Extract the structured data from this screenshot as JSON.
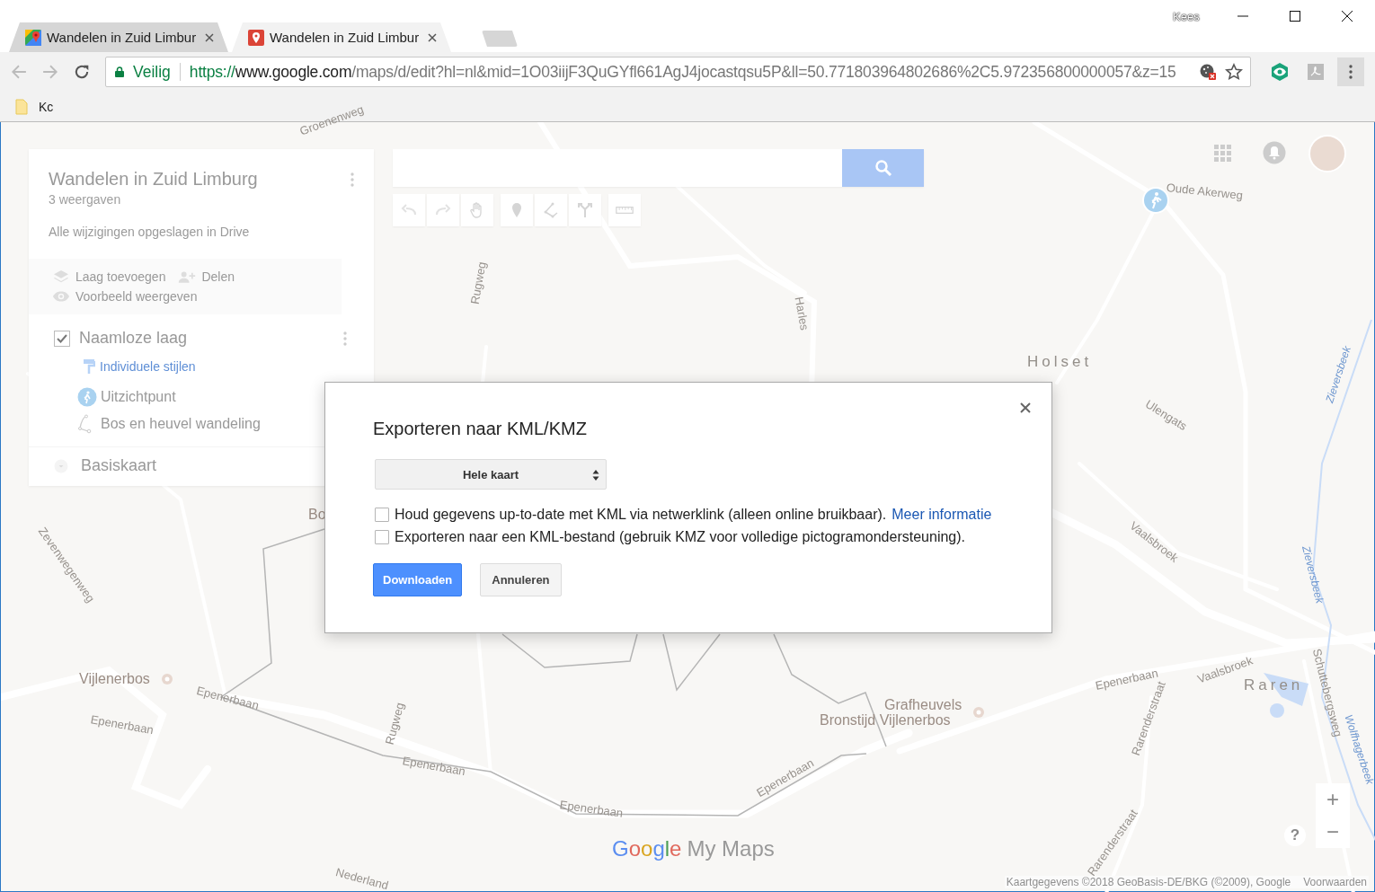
{
  "browser": {
    "tabs": [
      {
        "title": "Wandelen in Zuid Limbur",
        "selected": false
      },
      {
        "title": "Wandelen in Zuid Limbur",
        "selected": true
      }
    ],
    "profile": "Kees",
    "address": {
      "secure_label": "Veilig",
      "scheme": "https://",
      "host": "www.google.com",
      "path": "/maps/d/edit?hl=nl&mid=1O03iijF3QuGYfl661AgJ4jocastqsu5P&ll=50.771803964802686%2C5.972356800000057&z=15"
    },
    "bookmarks": [
      {
        "label": "Kc"
      }
    ]
  },
  "map_panel": {
    "title": "Wandelen in Zuid Limburg",
    "views": "3 weergaven",
    "save_status": "Alle wijzigingen opgeslagen in Drive",
    "actions": [
      {
        "label": "Laag toevoegen",
        "kind": "layers"
      },
      {
        "label": "Delen",
        "kind": "share"
      },
      {
        "label": "Voorbeeld weergeven",
        "kind": "preview"
      }
    ],
    "layer": {
      "name": "Naamloze laag",
      "checked": true,
      "style_link": "Individuele stijlen",
      "features": [
        {
          "label": "Uitzichtpunt",
          "kind": "point"
        },
        {
          "label": "Bos en heuvel wandeling",
          "kind": "line"
        }
      ]
    },
    "base_map": "Basiskaart"
  },
  "map_labels": [
    {
      "text": "Groenenweg",
      "kind": "road"
    },
    {
      "text": "Rugweg",
      "kind": "road"
    },
    {
      "text": "Harles",
      "kind": "road"
    },
    {
      "text": "Oude Akerweg",
      "kind": "road"
    },
    {
      "text": "Holset",
      "kind": "place"
    },
    {
      "text": "Ulengats",
      "kind": "road"
    },
    {
      "text": "Zieversbeek",
      "kind": "water"
    },
    {
      "text": "Vaalsbroek",
      "kind": "road"
    },
    {
      "text": "Zieversbeek",
      "kind": "water"
    },
    {
      "text": "Zevenwegenweg",
      "kind": "road"
    },
    {
      "text": "Vijlenerbos",
      "kind": "poi"
    },
    {
      "text": "Epenerbaan",
      "kind": "road"
    },
    {
      "text": "Epenerbaan",
      "kind": "road"
    },
    {
      "text": "Rugweg",
      "kind": "road"
    },
    {
      "text": "Epenerbaan",
      "kind": "road"
    },
    {
      "text": "Epenerbaan",
      "kind": "road"
    },
    {
      "text": "Epenerbaan",
      "kind": "road"
    },
    {
      "text": "Grafheuvels",
      "kind": "poi"
    },
    {
      "text": "Bronstijd Vijlenerbos",
      "kind": "poi"
    },
    {
      "text": "Epenerbaan",
      "kind": "road"
    },
    {
      "text": "Vaalsbroek",
      "kind": "road"
    },
    {
      "text": "Raren",
      "kind": "place"
    },
    {
      "text": "Rarenderstraat",
      "kind": "road"
    },
    {
      "text": "Schuttebergsweg",
      "kind": "road"
    },
    {
      "text": "Wolfhagerbeek",
      "kind": "water"
    },
    {
      "text": "Rarenderstraat",
      "kind": "road"
    },
    {
      "text": "Nederland",
      "kind": "road"
    },
    {
      "text": "Bo",
      "kind": "poi"
    }
  ],
  "dialog": {
    "title": "Exporteren naar KML/KMZ",
    "select_value": "Hele kaart",
    "options": [
      {
        "text": "Houd gegevens up-to-date met KML via netwerklink (alleen online bruikbaar).",
        "link": "Meer informatie",
        "checked": false
      },
      {
        "text": "Exporteren naar een KML-bestand (gebruik KMZ voor volledige pictogramondersteuning).",
        "checked": false
      }
    ],
    "buttons": [
      {
        "label": "Downloaden",
        "kind": "primary"
      },
      {
        "label": "Annuleren",
        "kind": "secondary"
      }
    ]
  },
  "logo": {
    "brand": "Google",
    "product": "My Maps"
  },
  "zoom": {
    "plus": "+",
    "minus": "−"
  },
  "help": "?",
  "attribution": "Kaartgegevens ©2018 GeoBasis-DE/BKG (©2009), Google",
  "terms": "Voorwaarden"
}
